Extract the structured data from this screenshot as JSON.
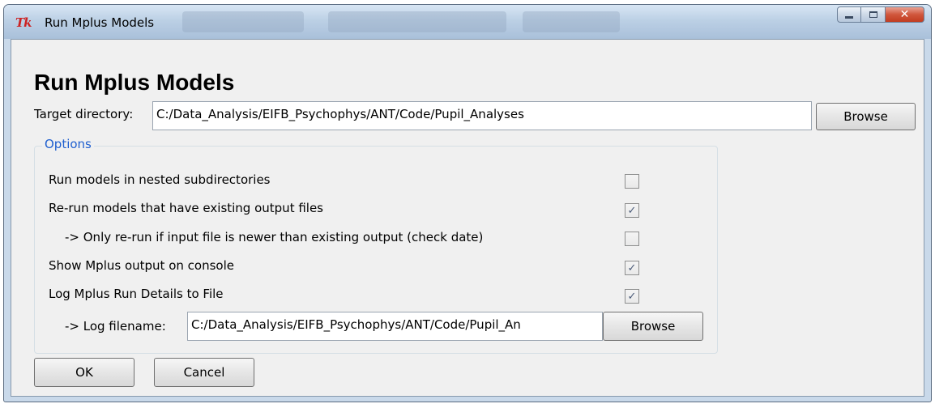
{
  "window": {
    "title": "Run Mplus Models",
    "app_icon": "Tk",
    "controls": {
      "minimize": "minimize-icon",
      "maximize": "maximize-icon",
      "close": "close-icon"
    }
  },
  "heading": "Run Mplus Models",
  "target": {
    "label": "Target directory:",
    "value": "C:/Data_Analysis/EIFB_Psychophys/ANT/Code/Pupil_Analyses",
    "browse_label": "Browse"
  },
  "options": {
    "title": "Options",
    "items": [
      {
        "label": "Run models in nested subdirectories",
        "checked": false
      },
      {
        "label": "Re-run models that have existing output files",
        "checked": true
      },
      {
        "label": "-> Only re-run if input file is newer than existing output (check date)",
        "checked": false
      },
      {
        "label": "Show Mplus output on console",
        "checked": true
      },
      {
        "label": "Log Mplus Run Details to File",
        "checked": true
      }
    ],
    "log": {
      "label": "-> Log filename:",
      "value": "C:/Data_Analysis/EIFB_Psychophys/ANT/Code/Pupil_An",
      "browse_label": "Browse"
    }
  },
  "buttons": {
    "ok": "OK",
    "cancel": "Cancel"
  },
  "colors": {
    "group_title": "#1f5fcf",
    "close_button": "#c13b20",
    "check_mark": "#4a5a78"
  }
}
